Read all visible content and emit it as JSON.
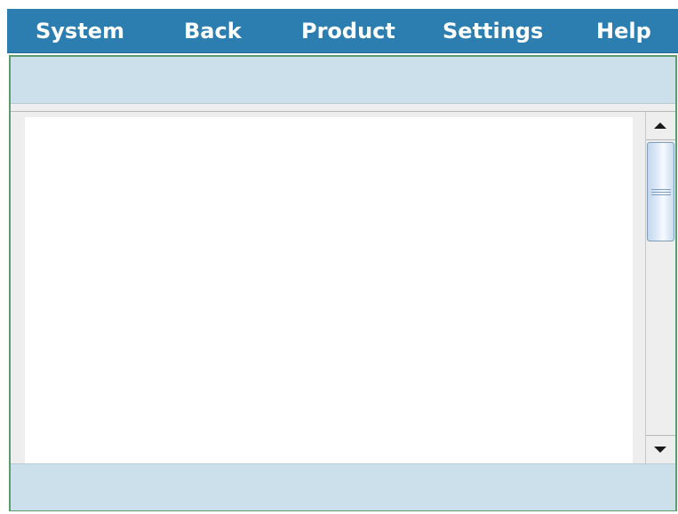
{
  "menubar": {
    "items": [
      {
        "label": "System"
      },
      {
        "label": "Back"
      },
      {
        "label": "Product"
      },
      {
        "label": "Settings"
      },
      {
        "label": "Help"
      }
    ]
  },
  "colors": {
    "menubar_bg": "#2d7eb0",
    "menu_text": "#ffffff",
    "panel_bg": "#cbe0eb",
    "frame_border": "#5c9b6a",
    "content_bg": "#ffffff"
  },
  "icons": {
    "scroll_up": "scroll-up-arrow-icon",
    "scroll_down": "scroll-down-arrow-icon"
  }
}
